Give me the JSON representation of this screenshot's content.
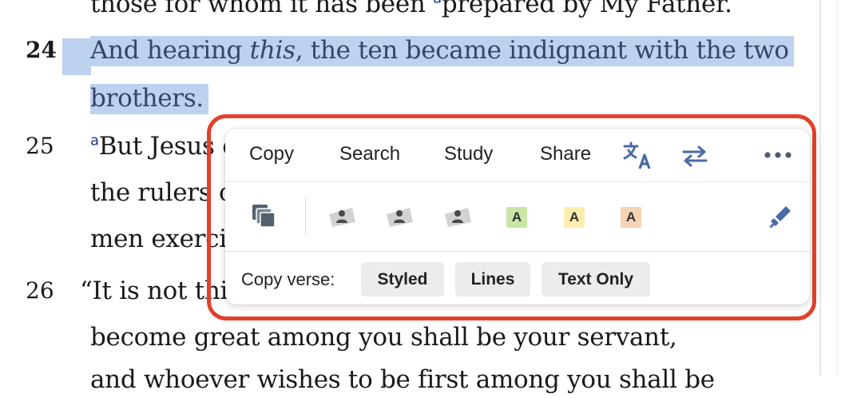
{
  "passage": {
    "line_top": "those for whom it has been ",
    "line_top_fn": "a",
    "line_top_end": "prepared by My Father.",
    "v24_num": "24",
    "v24_a": "And hearing ",
    "v24_em": "this",
    "v24_b": ", the ten became indignant with the two",
    "v24_c": "brothers.",
    "v25_num": "25",
    "v25_fn": "a",
    "v25_a": "But Jesus c",
    "v25_b": "the rulers o",
    "v25_c": "men exerci",
    "v26_num": "26",
    "v26_a": "“It is not thi",
    "v26_b": "become great among you shall be your servant,",
    "v26_c": "and whoever wishes to be first among you shall be"
  },
  "popup": {
    "menu": {
      "copy": "Copy",
      "search": "Search",
      "study": "Study",
      "share": "Share"
    },
    "icons": {
      "translate": "translate-icon",
      "compare": "swap-arrows-icon",
      "more": "more-icon",
      "copy_all": "copy-stack-icon",
      "highlighter": "highlighter-icon"
    },
    "highlight_chips": [
      {
        "label": "A",
        "color": "#c8e6a6"
      },
      {
        "label": "A",
        "color": "#fbeeb0"
      },
      {
        "label": "A",
        "color": "#f6d3b4"
      }
    ],
    "copy_verse": {
      "label": "Copy verse:",
      "styled": "Styled",
      "lines": "Lines",
      "text_only": "Text Only"
    },
    "outline_color": "#e1412b"
  }
}
